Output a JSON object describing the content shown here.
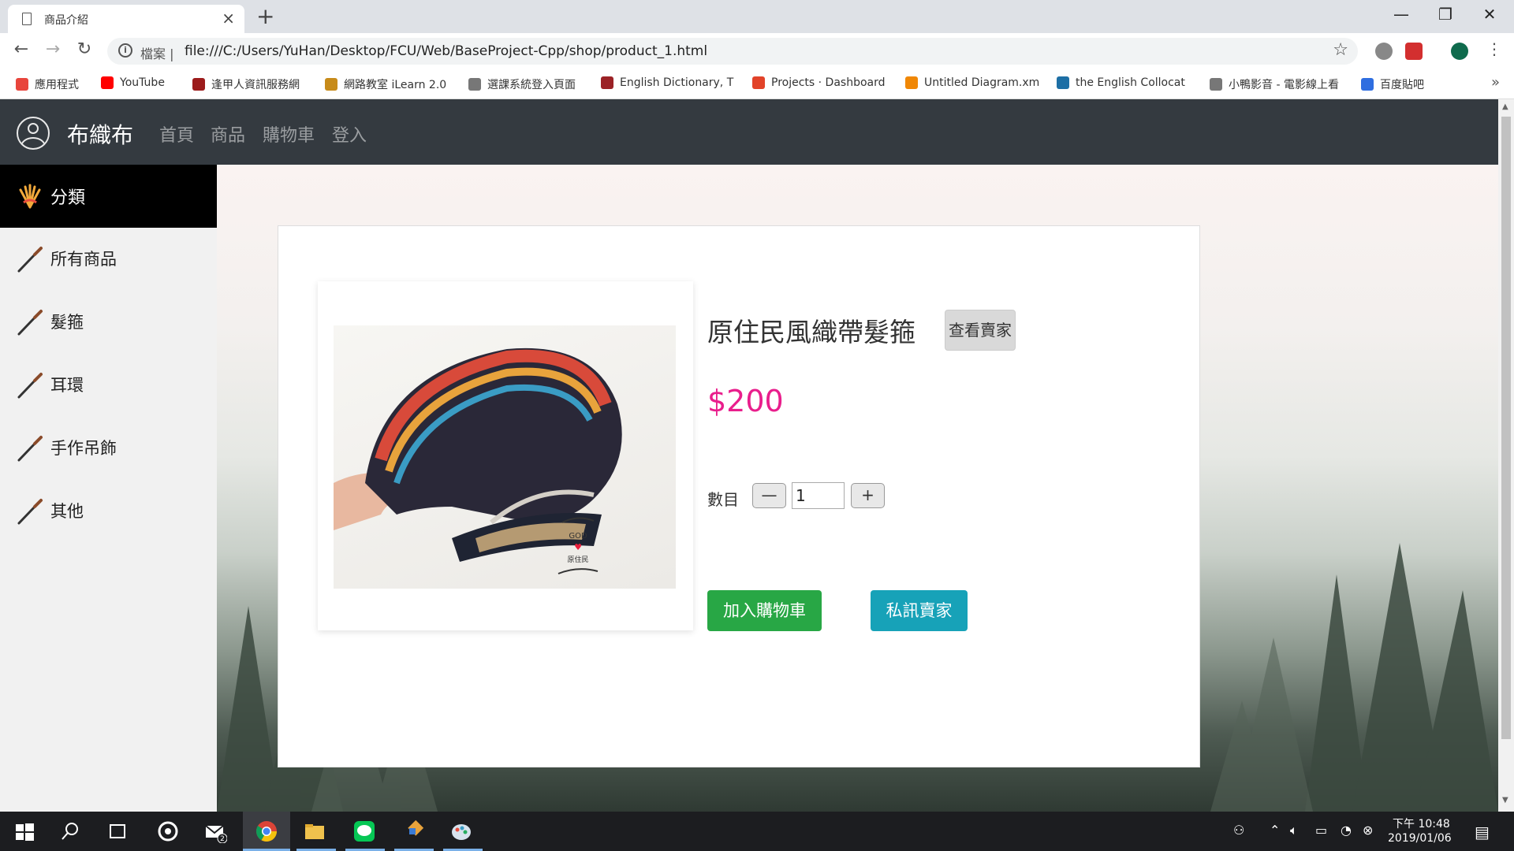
{
  "browser": {
    "tab_title": "商品介紹",
    "tab_close": "×",
    "new_tab": "+",
    "address_prefix": "檔案",
    "url": "file:///C:/Users/YuHan/Desktop/FCU/Web/BaseProject-Cpp/shop/product_1.html",
    "window_controls": {
      "minimize": "—",
      "maximize": "❐",
      "close": "✕"
    }
  },
  "bookmarks": [
    {
      "label": "應用程式",
      "color": "#e8453c"
    },
    {
      "label": "YouTube",
      "color": "#ff0000"
    },
    {
      "label": "逢甲人資訊服務網",
      "color": "#9c1b1b"
    },
    {
      "label": "網路教室 iLearn 2.0",
      "color": "#c78b1a"
    },
    {
      "label": "選課系統登入頁面",
      "color": "#777777"
    },
    {
      "label": "English Dictionary, T",
      "color": "#9b2226"
    },
    {
      "label": "Projects · Dashboard",
      "color": "#e24329"
    },
    {
      "label": "Untitled Diagram.xm",
      "color": "#f08705"
    },
    {
      "label": "the English Collocat",
      "color": "#1d6fa5"
    },
    {
      "label": "小鴨影音 - 電影線上看",
      "color": "#777777"
    },
    {
      "label": "百度貼吧",
      "color": "#2f6ee0"
    }
  ],
  "bookmarks_more": "»",
  "site": {
    "brand": "布織布",
    "nav": [
      {
        "label": "首頁",
        "active": true
      },
      {
        "label": "商品",
        "active": false
      },
      {
        "label": "購物車",
        "active": false
      },
      {
        "label": "登入",
        "active": false
      }
    ]
  },
  "sidebar": {
    "header": "分類",
    "items": [
      {
        "label": "所有商品"
      },
      {
        "label": "髮箍"
      },
      {
        "label": "耳環"
      },
      {
        "label": "手作吊飾"
      },
      {
        "label": "其他"
      }
    ]
  },
  "product": {
    "title": "原住民風織帶髮箍",
    "view_seller": "查看賣家",
    "price": "$200",
    "quantity_label": "數目",
    "minus": "—",
    "plus": "+",
    "quantity": "1",
    "add_to_cart": "加入購物車",
    "message_seller": "私訊賣家",
    "photo_caption_1": "GOD",
    "photo_caption_2": "原住民"
  },
  "taskbar": {
    "time": "下午 10:48",
    "date": "2019/01/06",
    "mail_badge": "2"
  }
}
